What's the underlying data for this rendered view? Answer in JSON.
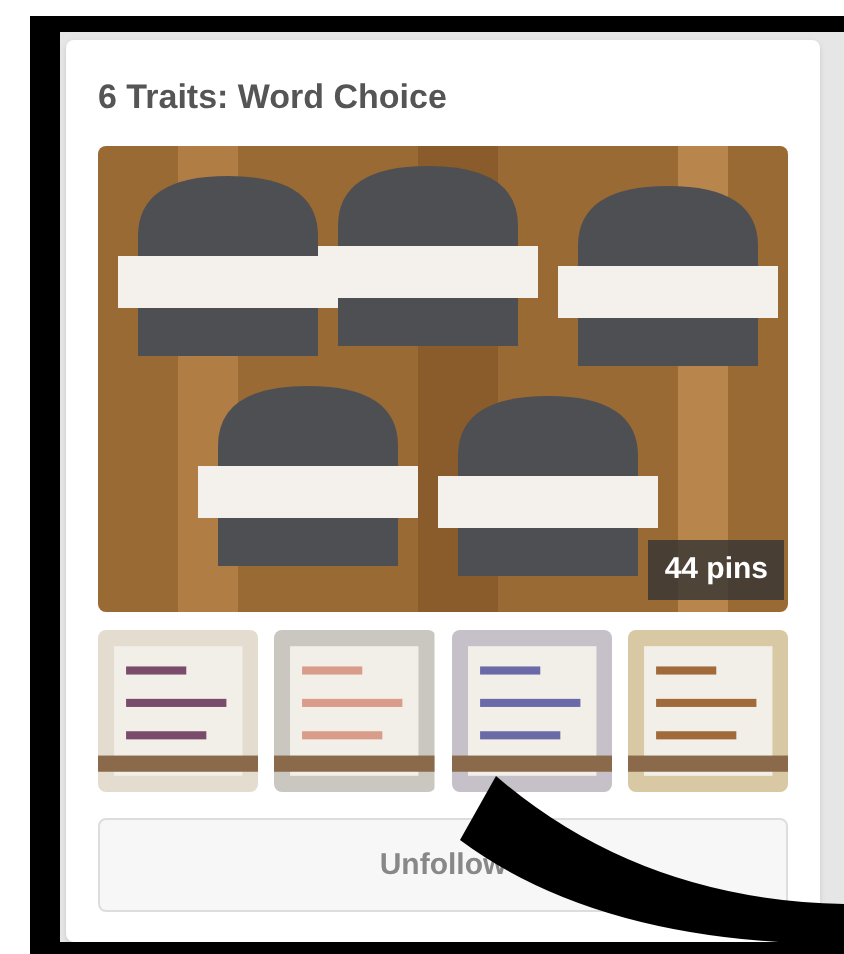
{
  "board": {
    "title": "6 Traits: Word Choice",
    "pin_count": "44 pins",
    "button": "Unfollow"
  }
}
